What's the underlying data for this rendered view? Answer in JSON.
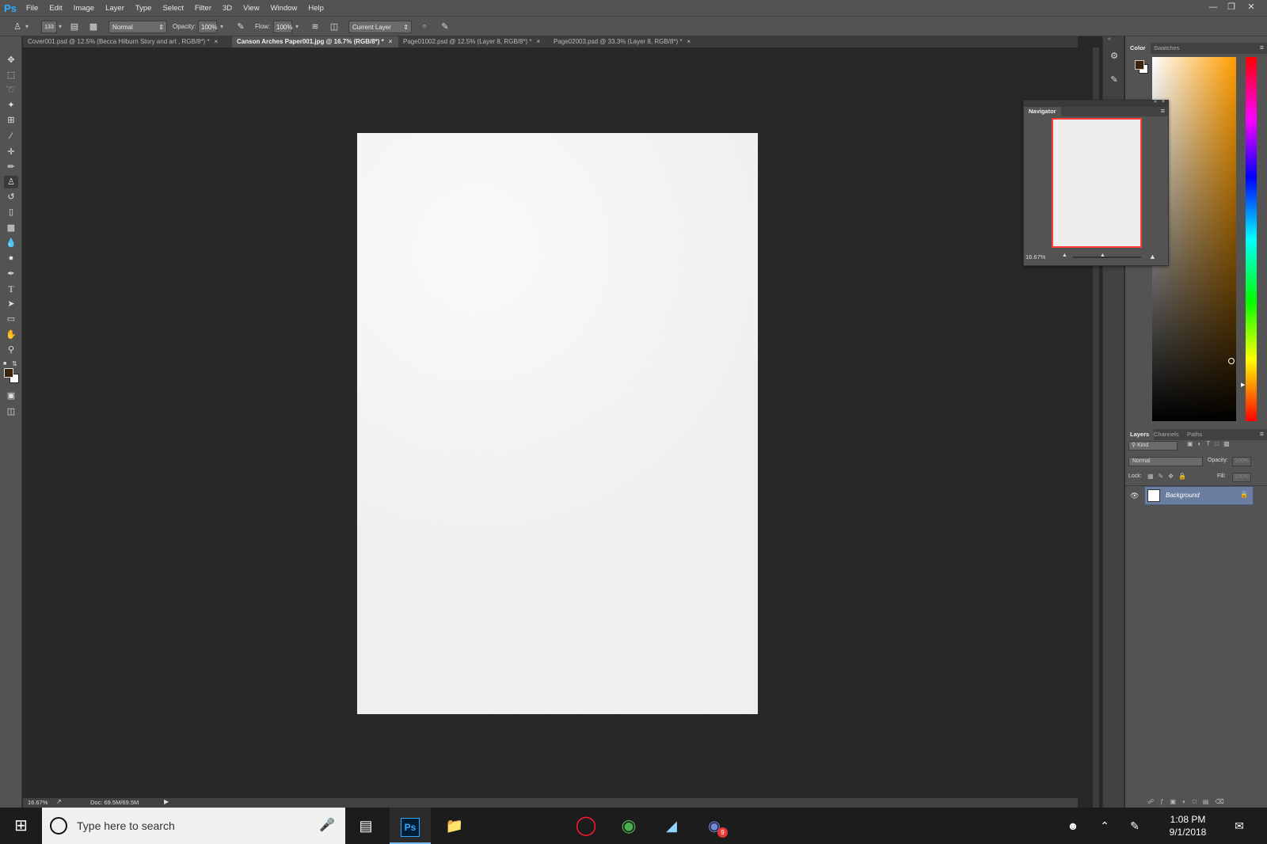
{
  "app": {
    "logo": "Ps"
  },
  "menubar": {
    "items": [
      "File",
      "Edit",
      "Image",
      "Layer",
      "Type",
      "Select",
      "Filter",
      "3D",
      "View",
      "Window",
      "Help"
    ],
    "window_controls": [
      "minimize-icon",
      "restore-icon",
      "close-icon"
    ]
  },
  "options": {
    "brush_size": "133",
    "mode": "Normal",
    "opacity_label": "Opacity:",
    "opacity_value": "100%",
    "flow_label": "Flow:",
    "flow_value": "100%",
    "sample": "Current Layer"
  },
  "tabs": [
    {
      "label": "Cover001.psd @ 12.5% (Becca Hilburn Story and art , RGB/8*) *",
      "active": false
    },
    {
      "label": "Canson Arches Paper001.jpg @ 16.7% (RGB/8*) *",
      "active": true
    },
    {
      "label": "Page01002.psd @ 12.5% (Layer 8, RGB/8*) *",
      "active": false
    },
    {
      "label": "Page02003.psd @ 33.3% (Layer 8, RGB/8*) *",
      "active": false
    }
  ],
  "tools": [
    "move-tool",
    "marquee-tool",
    "lasso-tool",
    "quick-select-tool",
    "crop-tool",
    "eyedropper-tool",
    "healing-brush-tool",
    "brush-tool",
    "clone-stamp-tool",
    "history-brush-tool",
    "eraser-tool",
    "gradient-tool",
    "blur-tool",
    "dodge-tool",
    "pen-tool",
    "type-tool",
    "path-select-tool",
    "rectangle-tool",
    "hand-tool",
    "zoom-tool"
  ],
  "colors": {
    "foreground": "#3a2410",
    "background": "#ffffff",
    "accent": "#31a8ff",
    "selected_layer": "#6b7ea0"
  },
  "status": {
    "zoom": "16.67%",
    "doc": "Doc: 69.5M/69.5M"
  },
  "color_panel": {
    "tabs": [
      "Color",
      "Swatches"
    ]
  },
  "navigator": {
    "title": "Navigator",
    "zoom": "16.67%"
  },
  "layers_panel": {
    "tabs": [
      "Layers",
      "Channels",
      "Paths"
    ],
    "filter_label": "Kind",
    "blend_mode": "Normal",
    "opacity_label": "Opacity:",
    "opacity_value": "100%",
    "lock_label": "Lock:",
    "fill_label": "Fill:",
    "fill_value": "100%",
    "layers": [
      {
        "name": "Background",
        "locked": true,
        "visible": true
      }
    ]
  },
  "taskbar": {
    "search_placeholder": "Type here to search",
    "discord_badge": "9",
    "time": "1:08 PM",
    "date": "9/1/2018"
  }
}
